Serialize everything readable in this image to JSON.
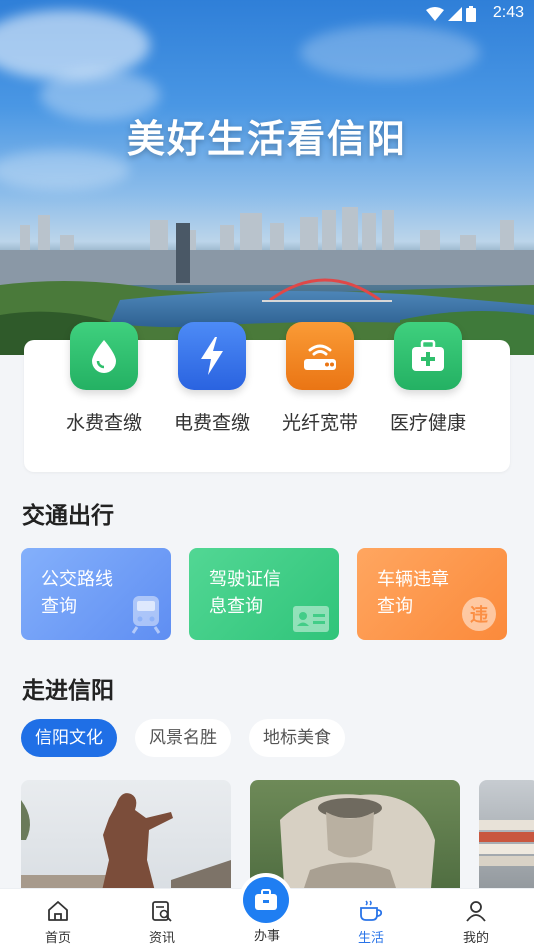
{
  "status_bar": {
    "time": "2:43"
  },
  "hero": {
    "title": "美好生活看信阳"
  },
  "services": [
    {
      "label": "水费查缴",
      "icon": "water-drop-icon",
      "color": "#2fbf6c"
    },
    {
      "label": "电费查缴",
      "icon": "lightning-icon",
      "color": "#3b78f0"
    },
    {
      "label": "光纤宽带",
      "icon": "router-icon",
      "color": "#f08a24"
    },
    {
      "label": "医疗健康",
      "icon": "medical-kit-icon",
      "color": "#2fbf6c"
    }
  ],
  "transport": {
    "title": "交通出行",
    "cards": [
      {
        "line1": "公交路线",
        "line2": "查询",
        "icon": "bus-icon",
        "color": "#6b9cf6"
      },
      {
        "line1": "驾驶证信",
        "line2": "息查询",
        "icon": "id-card-icon",
        "color": "#3fcd85"
      },
      {
        "line1": "车辆违章",
        "line2": "查询",
        "icon": "violation-icon",
        "color": "#fd9a4f"
      }
    ]
  },
  "explore": {
    "title": "走进信阳",
    "tabs": [
      {
        "label": "信阳文化",
        "active": true
      },
      {
        "label": "风景名胜",
        "active": false
      },
      {
        "label": "地标美食",
        "active": false
      }
    ]
  },
  "bottom_nav": {
    "items": [
      {
        "label": "首页",
        "icon": "home-icon"
      },
      {
        "label": "资讯",
        "icon": "news-icon"
      },
      {
        "label": "办事",
        "icon": "briefcase-icon"
      },
      {
        "label": "生活",
        "icon": "coffee-cup-icon",
        "active": true
      },
      {
        "label": "我的",
        "icon": "user-icon"
      }
    ]
  }
}
